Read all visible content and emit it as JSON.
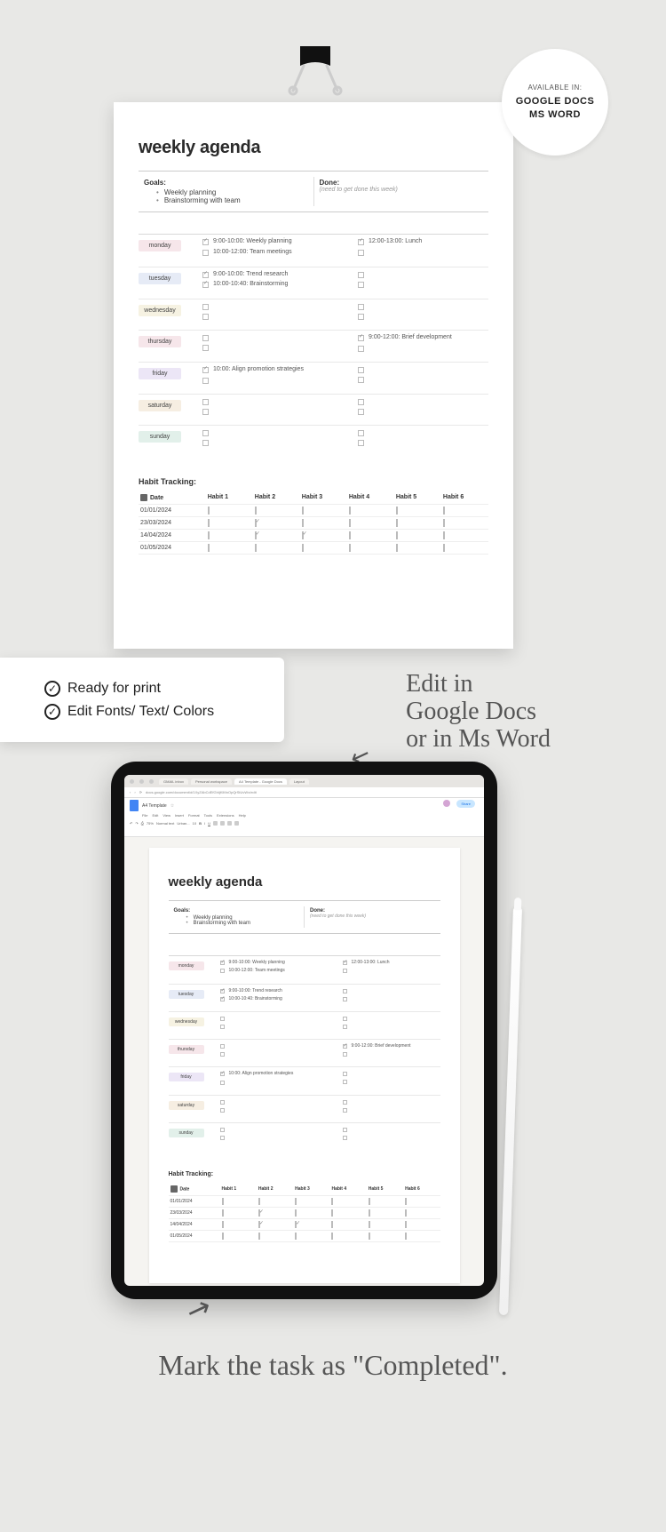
{
  "badge": {
    "top": "AVAILABLE IN:",
    "l1": "GOOGLE DOCS",
    "l2": "MS WORD"
  },
  "agenda": {
    "title": "weekly agenda",
    "goals_label": "Goals:",
    "goals": [
      "Weekly planning",
      "Brainstorming with team"
    ],
    "done_label": "Done:",
    "done_sub": "(need to get done this week)",
    "days": [
      {
        "name": "monday",
        "color": "#f6e6ea",
        "left": [
          {
            "c": true,
            "t": "9:00-10:00: Weekly planning"
          },
          {
            "c": false,
            "t": "10:00-12:00: Team meetings"
          }
        ],
        "right": [
          {
            "c": true,
            "t": "12:00-13:00: Lunch"
          },
          {
            "c": false,
            "t": ""
          }
        ]
      },
      {
        "name": "tuesday",
        "color": "#e6ebf6",
        "left": [
          {
            "c": true,
            "t": "9:00-10:00: Trend research"
          },
          {
            "c": true,
            "t": "10:00-10:40: Brainstorming"
          }
        ],
        "right": [
          {
            "c": false,
            "t": ""
          },
          {
            "c": false,
            "t": ""
          }
        ]
      },
      {
        "name": "wednesday",
        "color": "#f6f2e2",
        "left": [
          {
            "c": false,
            "t": ""
          },
          {
            "c": false,
            "t": ""
          }
        ],
        "right": [
          {
            "c": false,
            "t": ""
          },
          {
            "c": false,
            "t": ""
          }
        ]
      },
      {
        "name": "thursday",
        "color": "#f6e6ea",
        "left": [
          {
            "c": false,
            "t": ""
          },
          {
            "c": false,
            "t": ""
          }
        ],
        "right": [
          {
            "c": true,
            "t": "9:00-12:00: Brief development"
          },
          {
            "c": false,
            "t": ""
          }
        ]
      },
      {
        "name": "friday",
        "color": "#ece6f6",
        "left": [
          {
            "c": true,
            "t": "10:00: Align promotion strategies"
          },
          {
            "c": false,
            "t": ""
          }
        ],
        "right": [
          {
            "c": false,
            "t": ""
          },
          {
            "c": false,
            "t": ""
          }
        ]
      },
      {
        "name": "saturday",
        "color": "#f6eee2",
        "left": [
          {
            "c": false,
            "t": ""
          },
          {
            "c": false,
            "t": ""
          }
        ],
        "right": [
          {
            "c": false,
            "t": ""
          },
          {
            "c": false,
            "t": ""
          }
        ]
      },
      {
        "name": "sunday",
        "color": "#e2f0ea",
        "left": [
          {
            "c": false,
            "t": ""
          },
          {
            "c": false,
            "t": ""
          }
        ],
        "right": [
          {
            "c": false,
            "t": ""
          },
          {
            "c": false,
            "t": ""
          }
        ]
      }
    ],
    "habit_title": "Habit Tracking:",
    "habit_headers": [
      "Date",
      "Habit 1",
      "Habit 2",
      "Habit 3",
      "Habit 4",
      "Habit 5",
      "Habit 6"
    ],
    "habit_rows": [
      {
        "date": "01/01/2024",
        "v": [
          false,
          false,
          false,
          false,
          false,
          false
        ]
      },
      {
        "date": "23/03/2024",
        "v": [
          false,
          true,
          false,
          false,
          false,
          false
        ]
      },
      {
        "date": "14/04/2024",
        "v": [
          false,
          true,
          true,
          false,
          false,
          false
        ]
      },
      {
        "date": "01/05/2024",
        "v": [
          false,
          false,
          false,
          false,
          false,
          false
        ]
      }
    ]
  },
  "features": {
    "f1": "Ready for print",
    "f2": "Edit Fonts/ Text/ Colors"
  },
  "hand": {
    "top": "Edit in\nGoogle Docs\nor in Ms Word",
    "bot": "Mark the task as \"Completed\"."
  },
  "browser": {
    "tabs": [
      "GMAIL inbox",
      "Personal workspace",
      "A4 Template - Google Docs",
      "Layout"
    ],
    "url": "docs.google.com/document/d/1XyZAbCdEfGhIjKlMnOpQrStUvWx/edit",
    "doc_title": "A4 Template",
    "star": "☆",
    "menu": [
      "File",
      "Edit",
      "View",
      "Insert",
      "Format",
      "Tools",
      "Extensions",
      "Help"
    ],
    "zoom": "75%",
    "font": "Normal text",
    "fontfam": "Urban...",
    "fontsize": "10",
    "share": "Share"
  }
}
